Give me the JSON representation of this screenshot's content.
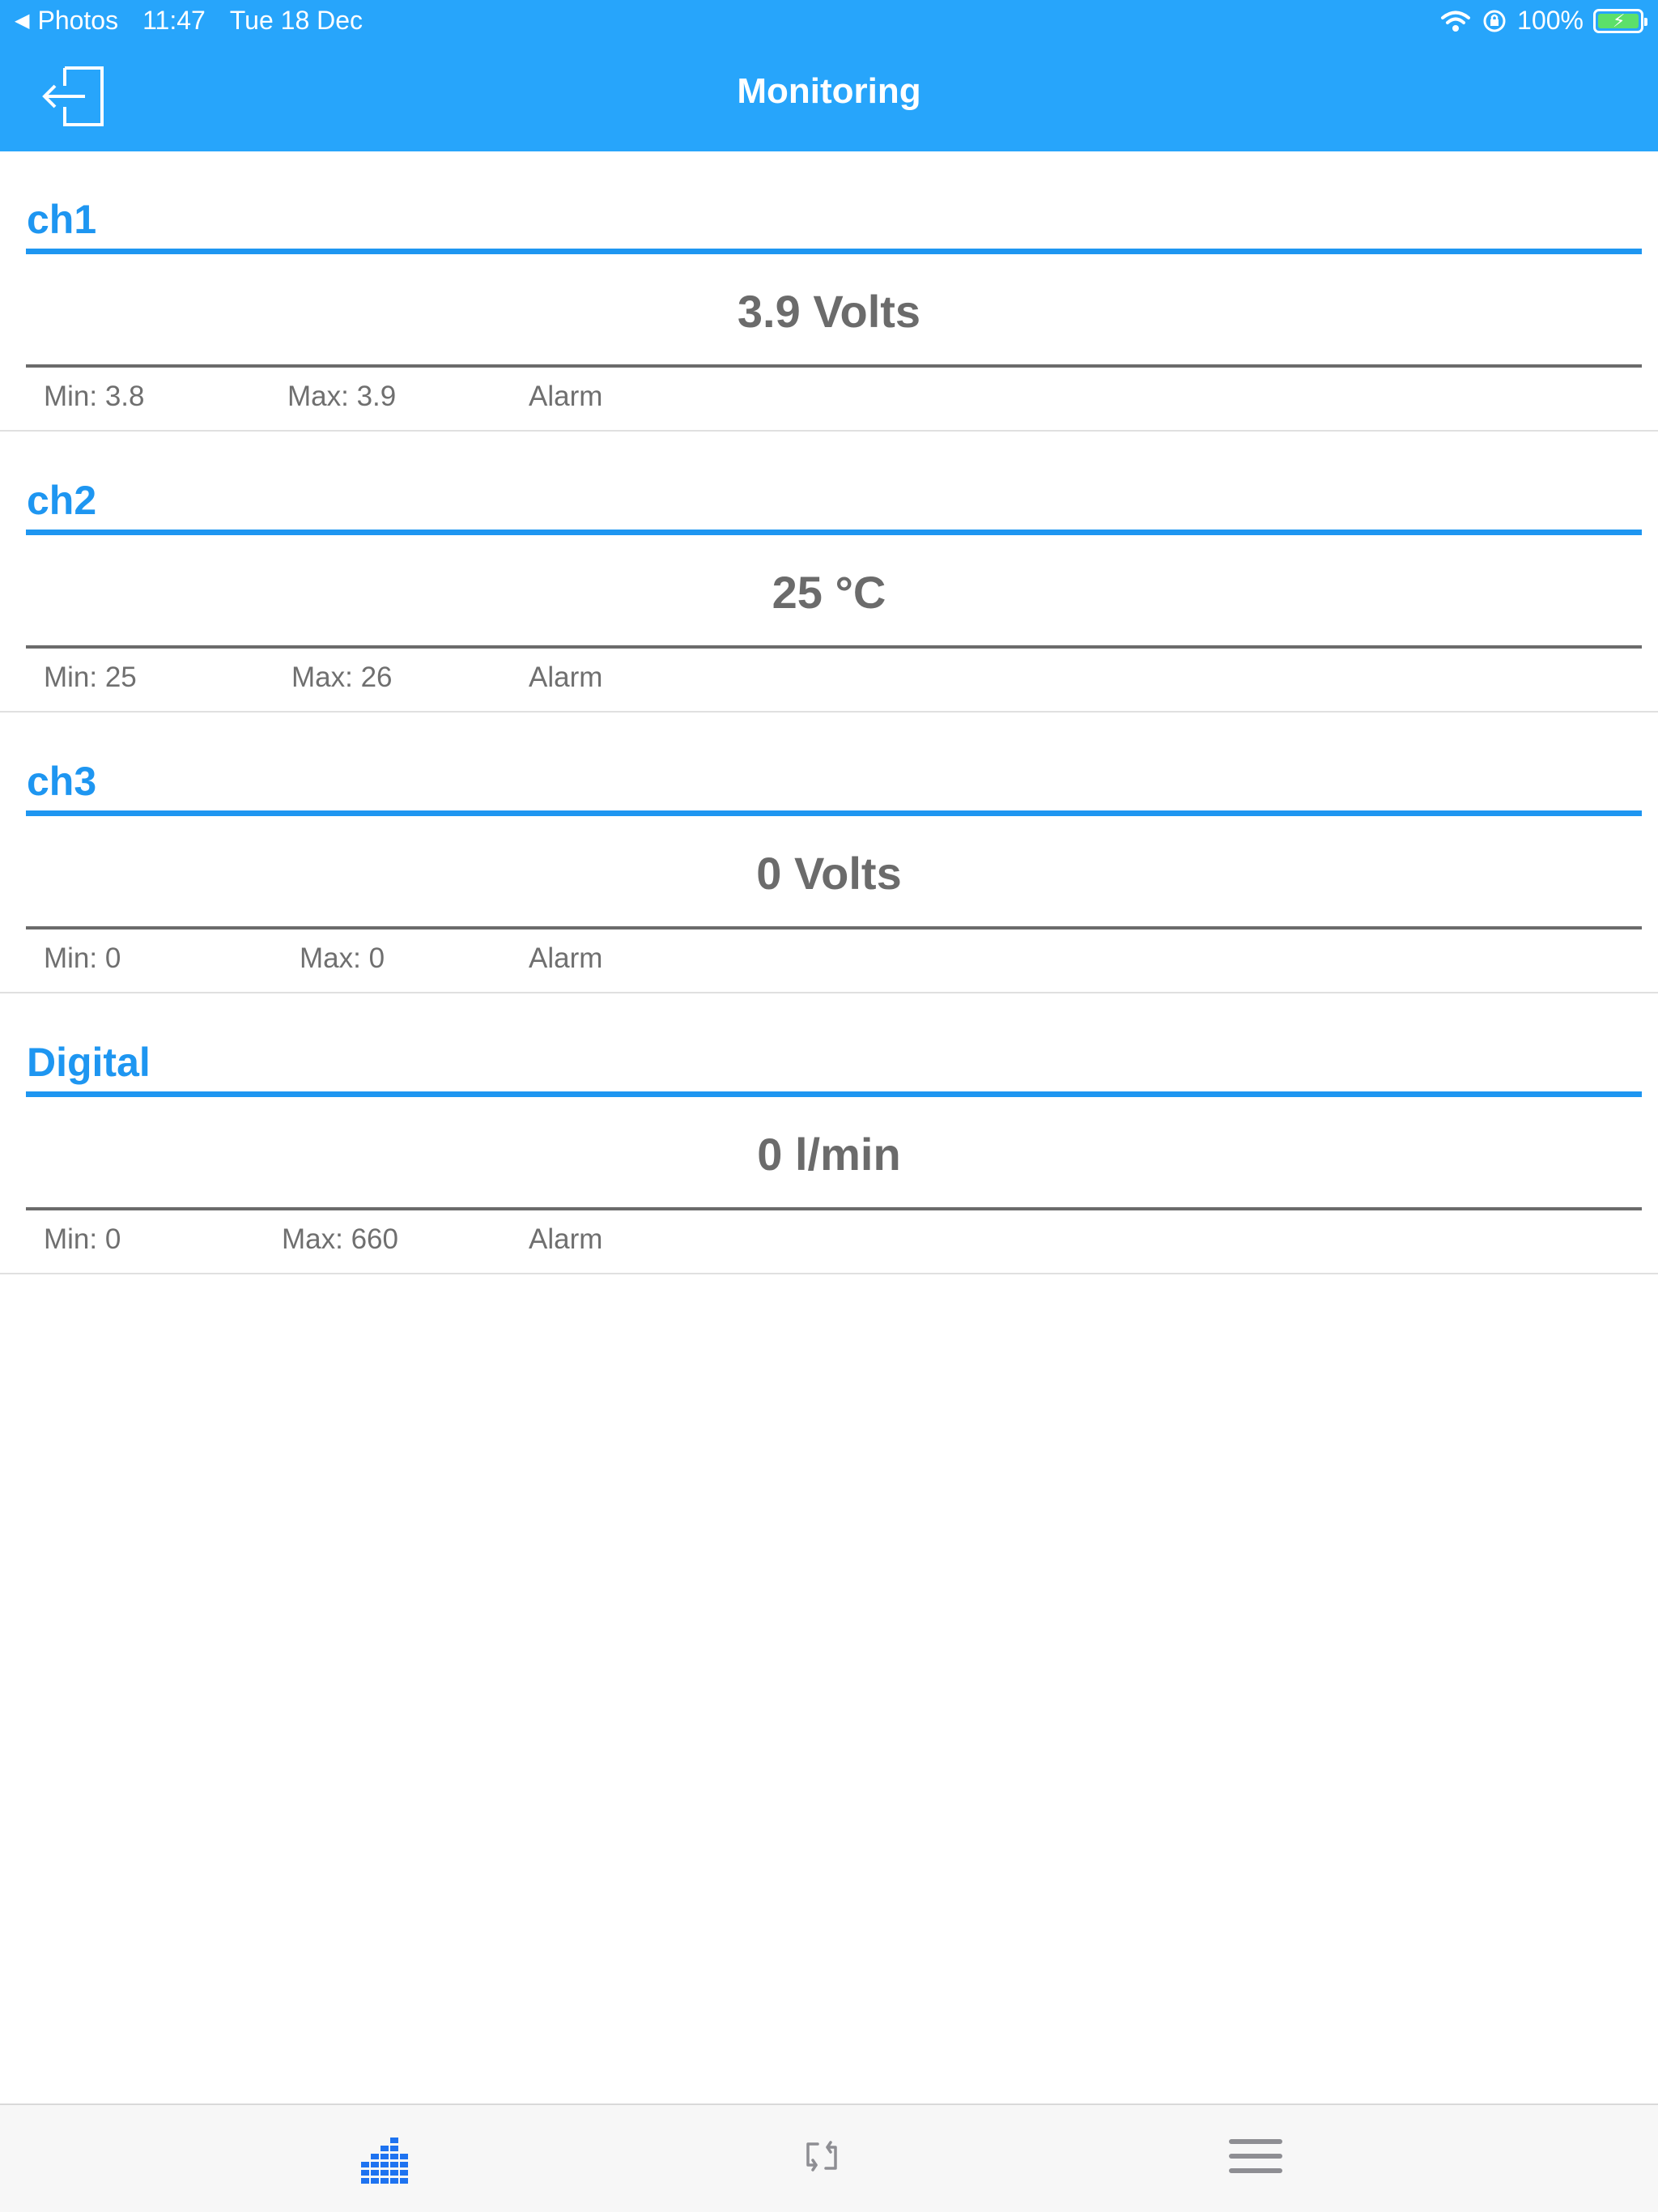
{
  "status_bar": {
    "back_app": "Photos",
    "time": "11:47",
    "date": "Tue 18 Dec",
    "battery": "100%",
    "battery_color": "#5ce06a"
  },
  "header": {
    "title": "Monitoring",
    "exit_icon": "logout-icon",
    "background": "#27a5fb"
  },
  "channels": [
    {
      "name": "ch1",
      "value": "3.9 Volts",
      "min": "Min: 3.8",
      "max": "Max: 3.9",
      "alarm": "Alarm"
    },
    {
      "name": "ch2",
      "value": "25 °C",
      "min": "Min: 25",
      "max": "Max: 26",
      "alarm": "Alarm"
    },
    {
      "name": "ch3",
      "value": "0 Volts",
      "min": "Min: 0",
      "max": "Max: 0",
      "alarm": "Alarm"
    },
    {
      "name": "Digital",
      "value": "0 l/min",
      "min": "Min: 0",
      "max": "Max: 660",
      "alarm": "Alarm"
    }
  ],
  "tab_bar": {
    "tabs": [
      {
        "icon": "equalizer-icon",
        "selected": true
      },
      {
        "icon": "sync-icon",
        "selected": false
      },
      {
        "icon": "menu-icon",
        "selected": false
      }
    ],
    "accent": "#1e73f0"
  }
}
